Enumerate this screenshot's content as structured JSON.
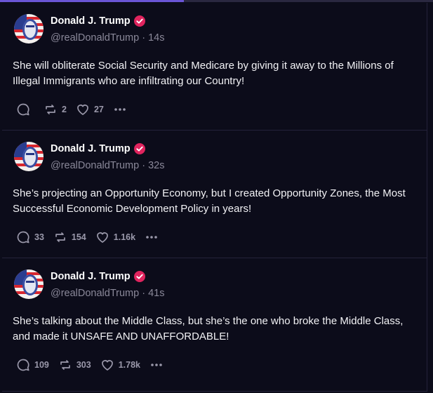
{
  "posts": [
    {
      "author": "Donald J. Trump",
      "handle": "@realDonaldTrump",
      "time": "14s",
      "text": "She will obliterate Social Security and Medicare by giving it away to the Millions of Illegal Immigrants who are infiltrating our Country!",
      "replies": "",
      "reposts": "2",
      "likes": "27"
    },
    {
      "author": "Donald J. Trump",
      "handle": "@realDonaldTrump",
      "time": "32s",
      "text": "She’s projecting an Opportunity Economy, but I created Opportunity Zones, the Most Successful Economic Development Policy in years!",
      "replies": "33",
      "reposts": "154",
      "likes": "1.16k"
    },
    {
      "author": "Donald J. Trump",
      "handle": "@realDonaldTrump",
      "time": "41s",
      "text": "She’s talking about the Middle Class, but she’s the one who broke the Middle Class, and made it UNSAFE AND UNAFFORDABLE!",
      "replies": "109",
      "reposts": "303",
      "likes": "1.78k"
    }
  ],
  "separator": "·",
  "colors": {
    "background": "#0c0c1a",
    "verified": "#e0245e",
    "accent": "#6a55d6",
    "muted_text": "#8a8899"
  },
  "icons": {
    "reply": "reply-icon",
    "repost": "repost-icon",
    "like": "heart-icon",
    "more": "more-icon",
    "verified": "verified-badge-icon"
  }
}
